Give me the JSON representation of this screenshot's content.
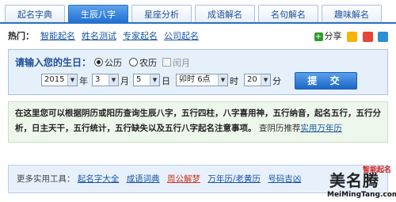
{
  "tabs": [
    {
      "label": "起名字典"
    },
    {
      "label": "生辰八字"
    },
    {
      "label": "星座分析"
    },
    {
      "label": "成语解名"
    },
    {
      "label": "名句解名"
    },
    {
      "label": "趣味解名"
    }
  ],
  "active_tab_index": 1,
  "hot": {
    "label": "热门：",
    "links": [
      "智能起名",
      "姓名测试",
      "专家起名",
      "公司起名"
    ],
    "share_label": "分享"
  },
  "birth_form": {
    "title": "请输入您的生日：",
    "calendar_options": [
      "公历",
      "农历",
      "闰月"
    ],
    "selected_calendar": "公历",
    "year": "2015",
    "year_unit": "年",
    "month": "3",
    "month_unit": "月",
    "day": "5",
    "day_unit": "日",
    "shichen": "卯时",
    "hour": "6点",
    "hour_unit": "时",
    "minute": "20",
    "minute_unit": "分",
    "submit_label": "提 交"
  },
  "description": {
    "text1": "在这里您可以根据阴历或阳历查询生辰八字，五行四柱，八字喜用神，五行纳音，起名五行，五行分析，日主天干，五行统计，五行缺失以及五行八字起名注意事项。",
    "text2": "查阴历推荐",
    "link": "实用万年历"
  },
  "tools": {
    "label": "更多实用工具：",
    "links": [
      "起名字大全",
      "成语词典",
      "周公解梦",
      "万年历/老黄历",
      "号码吉凶"
    ]
  },
  "watermark": {
    "small": "智能起名",
    "big": "美名腾",
    "url": "MeiMingTang.com"
  },
  "colors": {
    "accent": "#2a6fc5",
    "link": "#1a55a8",
    "red_link": "#d0311b"
  }
}
